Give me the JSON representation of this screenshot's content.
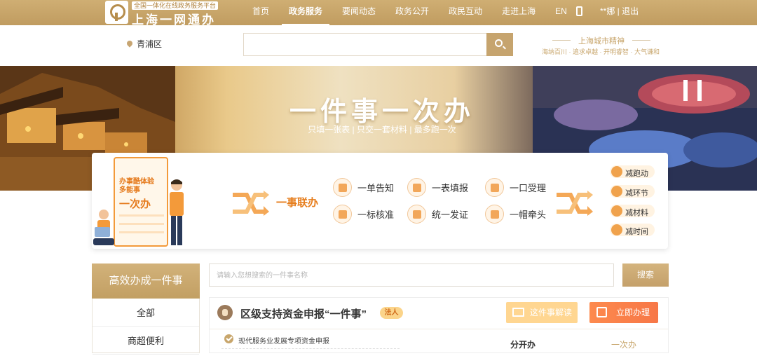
{
  "top_nav": {
    "logo_tag": "全国一体化在线政务服务平台",
    "logo_name": "上海一网通办",
    "items": [
      "首页",
      "政务服务",
      "要闻动态",
      "政务公开",
      "政民互动",
      "走进上海",
      "EN"
    ],
    "active_index": 1,
    "user": "**娜 | 退出"
  },
  "header": {
    "district": "青浦区",
    "search_value": "",
    "city_title": "上海城市精神",
    "city_sub": "海纳百川 · 追求卓越 · 开明睿智 · 大气谦和"
  },
  "banner": {
    "title": "一件事一次办",
    "subtitle": "只填一张表 | 只交一套材料 | 最多跑一次"
  },
  "card": {
    "note_line1": "办事酷体验",
    "note_line2": "多能事",
    "note_big": "一次办",
    "center_label": "一事联办",
    "features": [
      "一单告知",
      "一表填报",
      "一口受理",
      "一标核准",
      "统一发证",
      "一帽牵头"
    ],
    "reductions": [
      "减跑动",
      "减环节",
      "减材料",
      "减时间"
    ]
  },
  "sidebar": {
    "title": "高效办成一件事",
    "items": [
      "全部",
      "商超便利"
    ]
  },
  "query": {
    "placeholder": "请输入您想搜索的一件事名称",
    "button": "搜索"
  },
  "item": {
    "title": "区级支持资金申报“一件事”",
    "tag": "法人",
    "read_button": "这件事解读",
    "go_button": "立即办理",
    "sub_item": "现代服务业发展专项资金申报",
    "sub_dept": "分开办",
    "sub_mode": "一次办"
  },
  "colors": {
    "brand_gold": "#c8a66c",
    "orange": "#f77747",
    "light_orange": "#ffd691"
  }
}
